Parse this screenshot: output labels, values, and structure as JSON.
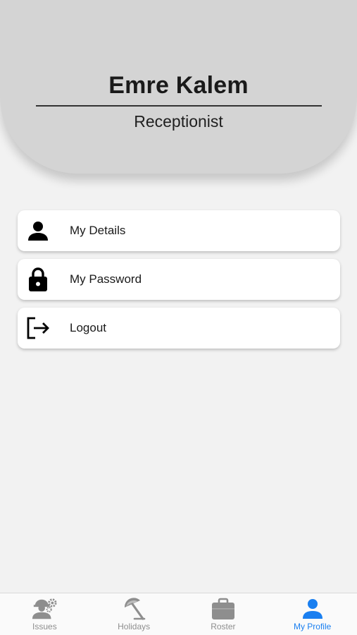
{
  "profile": {
    "name": "Emre Kalem",
    "role": "Receptionist"
  },
  "menu": {
    "items": [
      {
        "label": "My Details",
        "icon": "person-icon"
      },
      {
        "label": "My Password",
        "icon": "lock-icon"
      },
      {
        "label": "Logout",
        "icon": "logout-icon"
      }
    ]
  },
  "tabbar": {
    "tabs": [
      {
        "label": "Issues",
        "icon": "worker-gear-icon",
        "active": false
      },
      {
        "label": "Holidays",
        "icon": "beach-umbrella-icon",
        "active": false
      },
      {
        "label": "Roster",
        "icon": "briefcase-icon",
        "active": false
      },
      {
        "label": "My Profile",
        "icon": "person-icon",
        "active": true
      }
    ]
  },
  "colors": {
    "header_bg": "#d4d4d4",
    "page_bg": "#f2f2f2",
    "active_tab": "#1a7ff0",
    "inactive_tab": "#8e8e8e"
  }
}
